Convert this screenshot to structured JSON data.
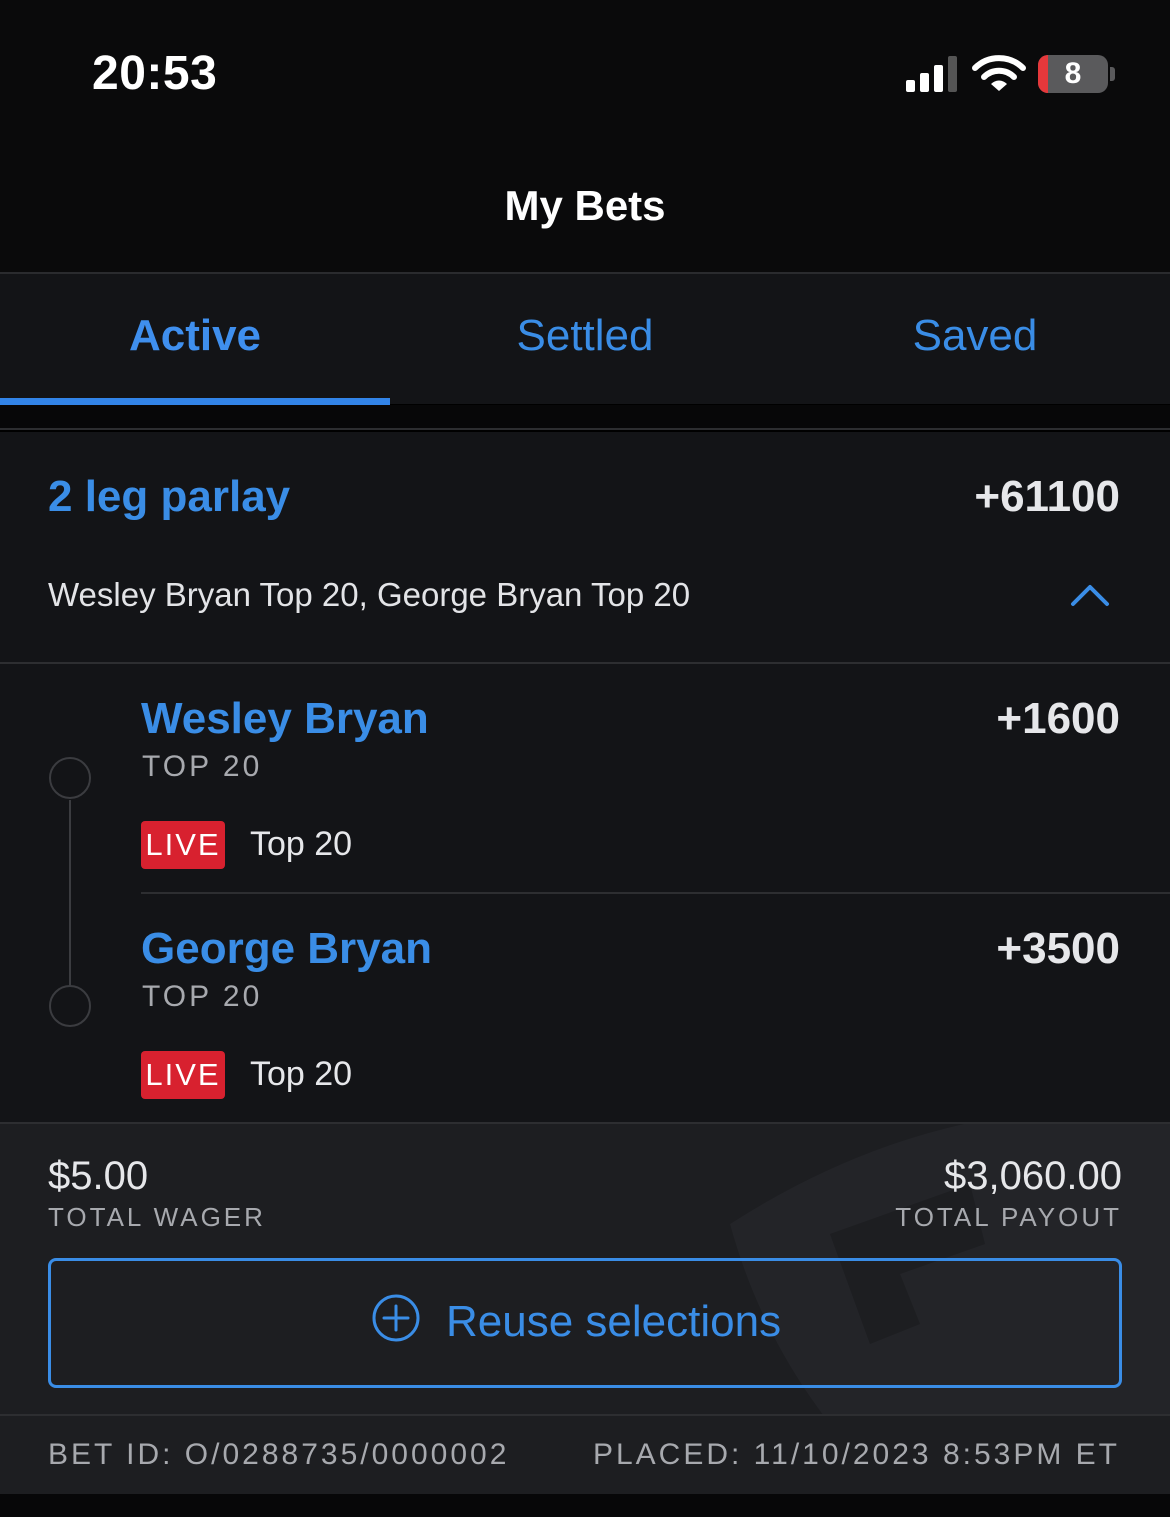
{
  "status_bar": {
    "time": "20:53",
    "battery_level": "8"
  },
  "nav": {
    "title": "My Bets"
  },
  "tabs": [
    {
      "label": "Active",
      "active": true
    },
    {
      "label": "Settled",
      "active": false
    },
    {
      "label": "Saved",
      "active": false
    }
  ],
  "bet": {
    "title": "2 leg parlay",
    "odds": "+61100",
    "summary": "Wesley Bryan Top 20, George Bryan Top 20",
    "legs": [
      {
        "name": "Wesley Bryan",
        "market": "TOP 20",
        "odds": "+1600",
        "badge": "LIVE",
        "status": "Top 20"
      },
      {
        "name": "George Bryan",
        "market": "TOP 20",
        "odds": "+3500",
        "badge": "LIVE",
        "status": "Top 20"
      }
    ],
    "total_wager": "$5.00",
    "total_wager_label": "TOTAL WAGER",
    "total_payout": "$3,060.00",
    "total_payout_label": "TOTAL PAYOUT",
    "reuse_label": "Reuse selections",
    "bet_id": "BET ID: O/0288735/0000002",
    "placed": "PLACED: 11/10/2023 8:53PM ET"
  },
  "icons": {
    "signal": "cellular-signal-icon",
    "wifi": "wifi-icon",
    "battery": "battery-icon",
    "chevron": "chevron-up-icon",
    "reuse": "plus-circle-icon",
    "watermark": "brand-shield-icon"
  },
  "colors": {
    "accent": "#3a8de6",
    "live": "#d8212f",
    "background": "#131417"
  }
}
